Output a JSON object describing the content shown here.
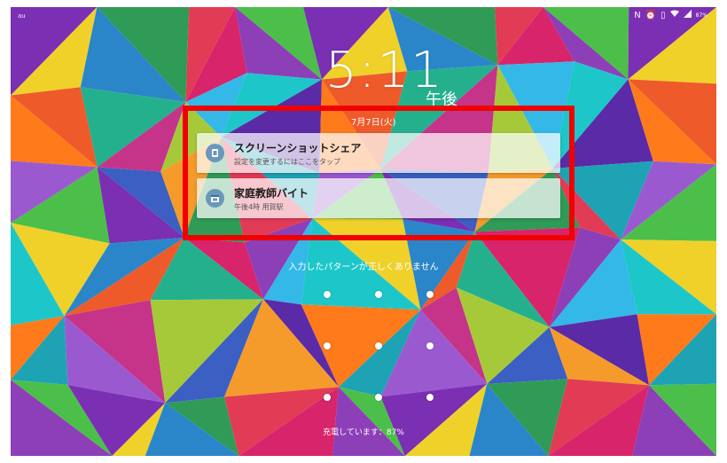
{
  "status_bar": {
    "carrier": "au",
    "battery_percent": "87%",
    "icons": [
      "nfc-icon",
      "alarm-icon",
      "vibrate-icon",
      "wifi-icon",
      "signal-icon",
      "battery-icon"
    ]
  },
  "lock_screen": {
    "time": "5:11",
    "ampm": "午後",
    "date": "7月7日(火)"
  },
  "notifications": [
    {
      "icon": "screenshot-share-icon",
      "title": "スクリーンショットシェア",
      "subtitle": "設定を変更するにはここをタップ"
    },
    {
      "icon": "calendar-icon",
      "title": "家庭教師バイト",
      "subtitle": "午後4時  用賀駅"
    }
  ],
  "unlock": {
    "message": "入力したパターンが正しくありません",
    "pattern_dots": 9
  },
  "charging": {
    "text": "充電しています：87%"
  },
  "colors": {
    "highlight": "#f00100",
    "notification_icon": "#6a98bd"
  }
}
